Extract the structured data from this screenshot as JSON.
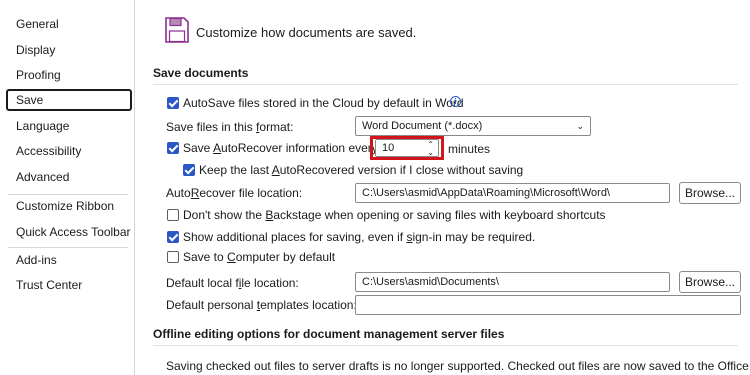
{
  "sidebar": {
    "items": [
      {
        "label": "General"
      },
      {
        "label": "Display"
      },
      {
        "label": "Proofing"
      },
      {
        "label": "Save"
      },
      {
        "label": "Language"
      },
      {
        "label": "Accessibility"
      },
      {
        "label": "Advanced"
      },
      {
        "label": "Customize Ribbon"
      },
      {
        "label": "Quick Access Toolbar"
      },
      {
        "label": "Add-ins"
      },
      {
        "label": "Trust Center"
      }
    ],
    "selected": "Save"
  },
  "header": {
    "icon": "save-floppy-icon",
    "text": "Customize how documents are saved."
  },
  "save_documents": {
    "title": "Save documents",
    "autosave_cloud": {
      "label": "AutoSave files stored in the Cloud by default in Word",
      "checked": true,
      "info_icon": "info-icon"
    },
    "format": {
      "label_pre": "Save files in this ",
      "label_u": "f",
      "label_post": "ormat:",
      "value": "Word Document (*.docx)"
    },
    "autorecover": {
      "label_pre": "Save ",
      "label_u": "A",
      "label_post": "utoRecover information every",
      "checked": true,
      "value": "10",
      "unit": "minutes"
    },
    "keep_last": {
      "label_pre": "Keep the last ",
      "label_u": "A",
      "label_post": "utoRecovered version if I close without saving",
      "checked": true
    },
    "autorecover_location": {
      "label_pre": "Auto",
      "label_u": "R",
      "label_post": "ecover file location:",
      "value": "C:\\Users\\asmid\\AppData\\Roaming\\Microsoft\\Word\\",
      "button": "Browse..."
    },
    "no_backstage": {
      "label_pre": "Don't show the ",
      "label_u": "B",
      "label_post": "ackstage when opening or saving files with keyboard shortcuts",
      "checked": false
    },
    "show_places": {
      "label_pre": "Show additional places for saving, even if ",
      "label_u": "s",
      "label_post": "ign-in may be required.",
      "checked": true
    },
    "save_to_computer": {
      "label_pre": "Save to ",
      "label_u": "C",
      "label_post": "omputer by default",
      "checked": false
    },
    "default_local": {
      "label_pre": "Default local f",
      "label_u": "i",
      "label_post": "le location:",
      "value": "C:\\Users\\asmid\\Documents\\",
      "button": "Browse..."
    },
    "default_templates": {
      "label_pre": "Default personal ",
      "label_u": "t",
      "label_post": "emplates location:",
      "value": ""
    }
  },
  "offline": {
    "title": "Offline editing options for document management server files",
    "text": "Saving checked out files to server drafts is no longer supported. Checked out files are now saved to the Office"
  },
  "colors": {
    "accent": "#2a56c6",
    "highlight": "#d4141c",
    "icon_purple": "#8b2f8f"
  }
}
